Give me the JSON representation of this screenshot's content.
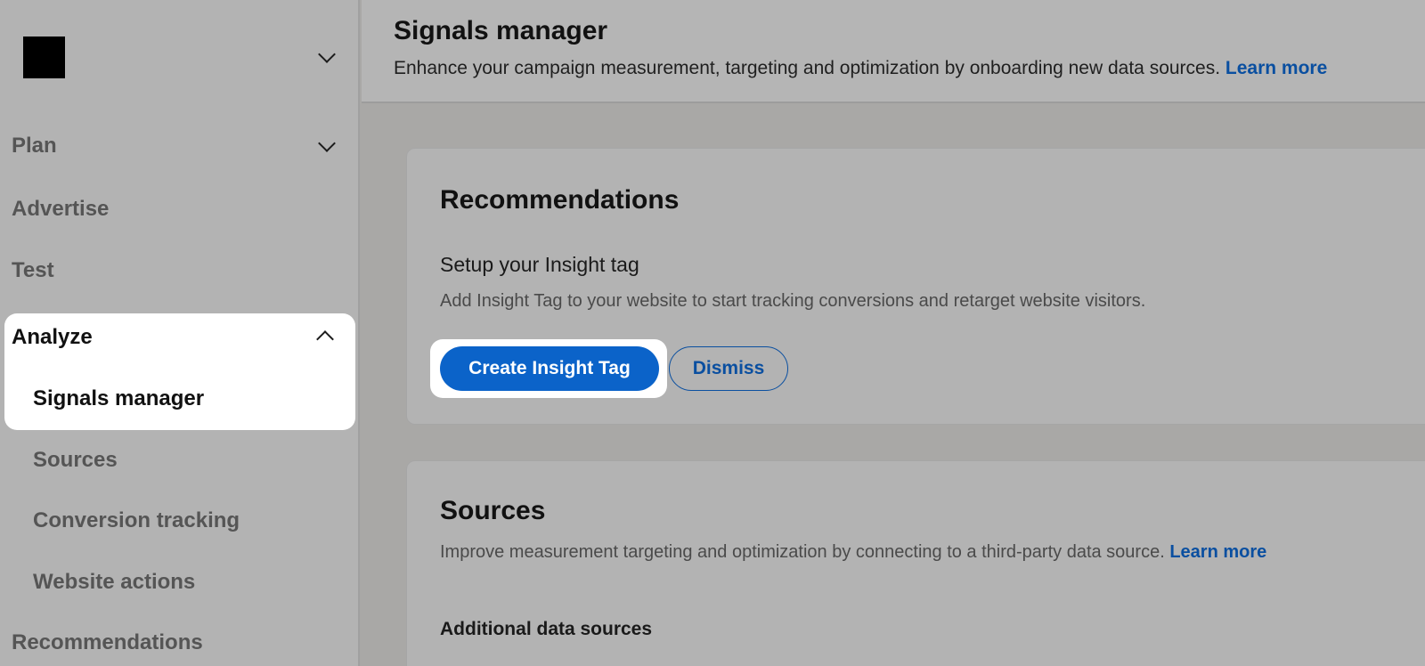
{
  "sidebar": {
    "items": {
      "plan": "Plan",
      "advertise": "Advertise",
      "test": "Test",
      "analyze": "Analyze",
      "recommendations": "Recommendations"
    },
    "analyze_subitems": {
      "signals_manager": "Signals manager",
      "sources": "Sources",
      "conversion_tracking": "Conversion tracking",
      "website_actions": "Website actions"
    },
    "icons": [
      "chevron-down-icon",
      "chevron-up-icon"
    ]
  },
  "header": {
    "title": "Signals manager",
    "subtitle": "Enhance your campaign measurement, targeting and optimization by onboarding new data sources.",
    "learn_more": "Learn more"
  },
  "recommendations_card": {
    "title": "Recommendations",
    "heading": "Setup your Insight tag",
    "description": "Add Insight Tag to your website to start tracking conversions and retarget website visitors.",
    "primary_button": "Create Insight Tag",
    "secondary_button": "Dismiss"
  },
  "sources_card": {
    "title": "Sources",
    "description": "Improve measurement targeting and optimization by connecting to a third-party data source.",
    "learn_more": "Learn more",
    "additional_label": "Additional data sources"
  },
  "colors": {
    "primary": "#0b63c9",
    "link": "#0a4fa0"
  }
}
